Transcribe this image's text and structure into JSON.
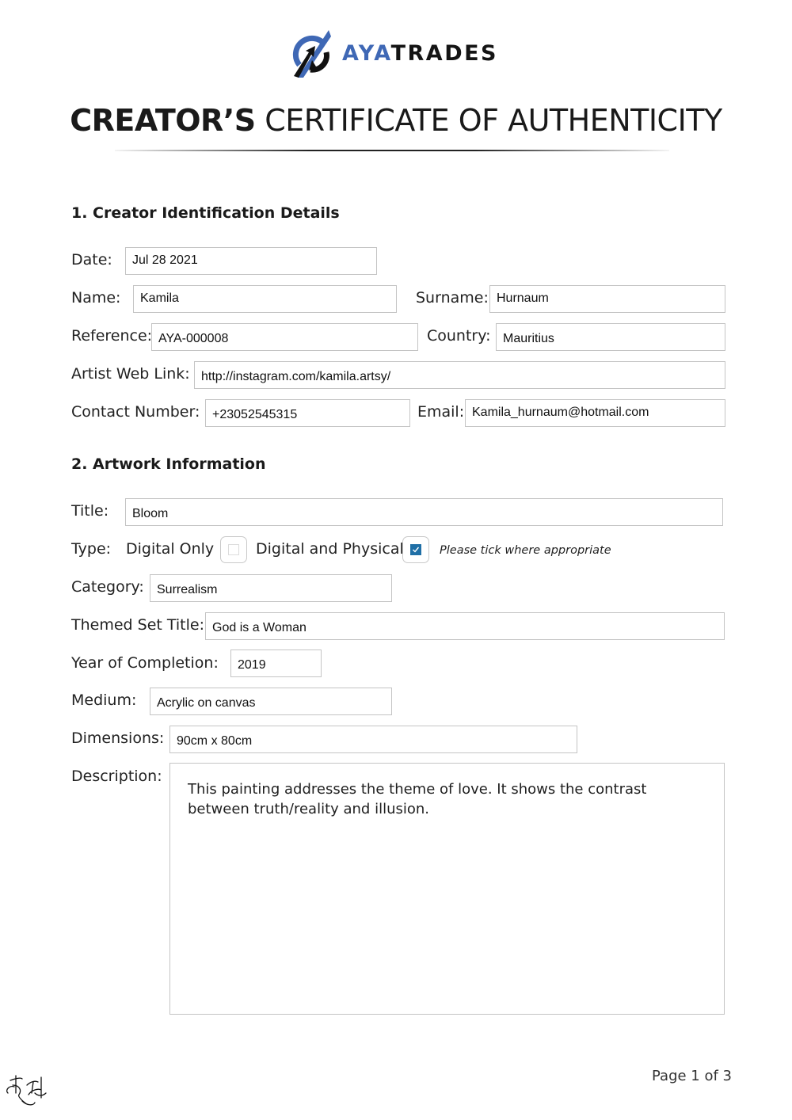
{
  "brand": {
    "name_part1": "AYA",
    "name_part2": "TRADES",
    "logo_icon": "ayatrades-logo-icon",
    "accent_color": "#3f68b5"
  },
  "document": {
    "title_bold": "CREATOR’S",
    "title_rest": " CERTIFICATE OF AUTHENTICITY"
  },
  "section1": {
    "heading": "1. Creator Identification Details",
    "date": {
      "label": "Date:",
      "value": "Jul 28 2021"
    },
    "name": {
      "label": "Name:",
      "value": "Kamila"
    },
    "surname": {
      "label": "Surname:",
      "value": "Hurnaum"
    },
    "reference": {
      "label": "Reference:",
      "value": "AYA-000008"
    },
    "country": {
      "label": "Country:",
      "value": "Mauritius"
    },
    "web_link": {
      "label": "Artist Web Link:",
      "value": "http://instagram.com/kamila.artsy/"
    },
    "contact": {
      "label": "Contact Number:",
      "value": "+23052545315"
    },
    "email": {
      "label": "Email:",
      "value": "Kamila_hurnaum@hotmail.com"
    }
  },
  "section2": {
    "heading": "2. Artwork Information",
    "title": {
      "label": "Title:",
      "value": "Bloom"
    },
    "type": {
      "label": "Type:",
      "options": [
        {
          "label": "Digital Only",
          "checked": false
        },
        {
          "label": "Digital and Physical",
          "checked": true
        }
      ],
      "hint": "Please tick where appropriate",
      "check_color": "#1f6fa6"
    },
    "category": {
      "label": "Category:",
      "value": "Surrealism"
    },
    "themed_set": {
      "label": "Themed Set Title:",
      "value": "God is a Woman"
    },
    "year": {
      "label": "Year of Completion:",
      "value": "2019"
    },
    "medium": {
      "label": "Medium:",
      "value": "Acrylic on canvas"
    },
    "dimensions": {
      "label": "Dimensions:",
      "value": "90cm x 80cm"
    },
    "description": {
      "label": "Description:",
      "value": "This painting addresses the theme of love. It shows the contrast between truth/reality and illusion."
    }
  },
  "footer": {
    "page": "Page 1 of 3",
    "signature_initials": "KH"
  }
}
